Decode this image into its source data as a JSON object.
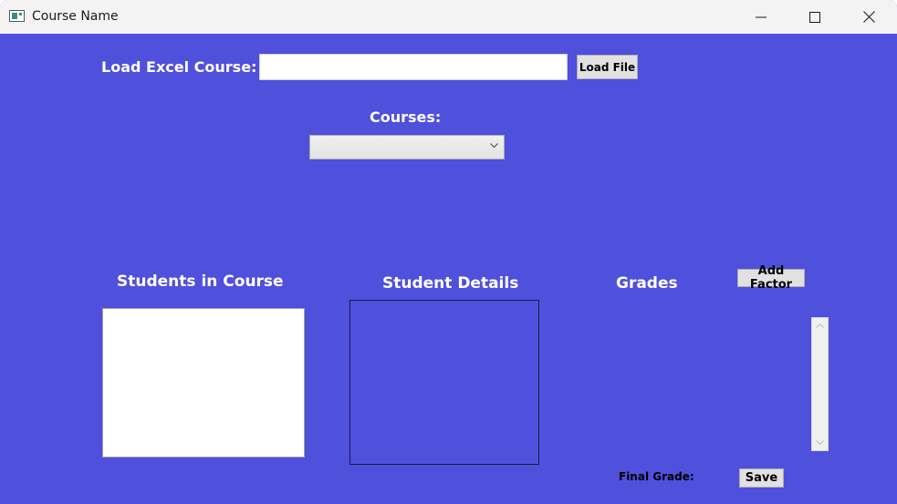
{
  "window": {
    "title": "Course Name",
    "controls": {
      "minimize": "minimize-icon",
      "maximize": "maximize-icon",
      "close": "close-icon"
    }
  },
  "load": {
    "label": "Load Excel Course:",
    "file_path_value": "",
    "button_label": "Load File"
  },
  "courses": {
    "label": "Courses:",
    "selected": ""
  },
  "students": {
    "label": "Students in Course",
    "items": []
  },
  "details": {
    "label": "Student Details"
  },
  "grades": {
    "label": "Grades",
    "add_factor_label": "Add Factor",
    "final_grade_label": "Final Grade:",
    "final_grade_value": "",
    "save_label": "Save"
  },
  "colors": {
    "background": "#4f50dc",
    "titlebar": "#f3f3f3",
    "button": "#e1e1e1"
  }
}
